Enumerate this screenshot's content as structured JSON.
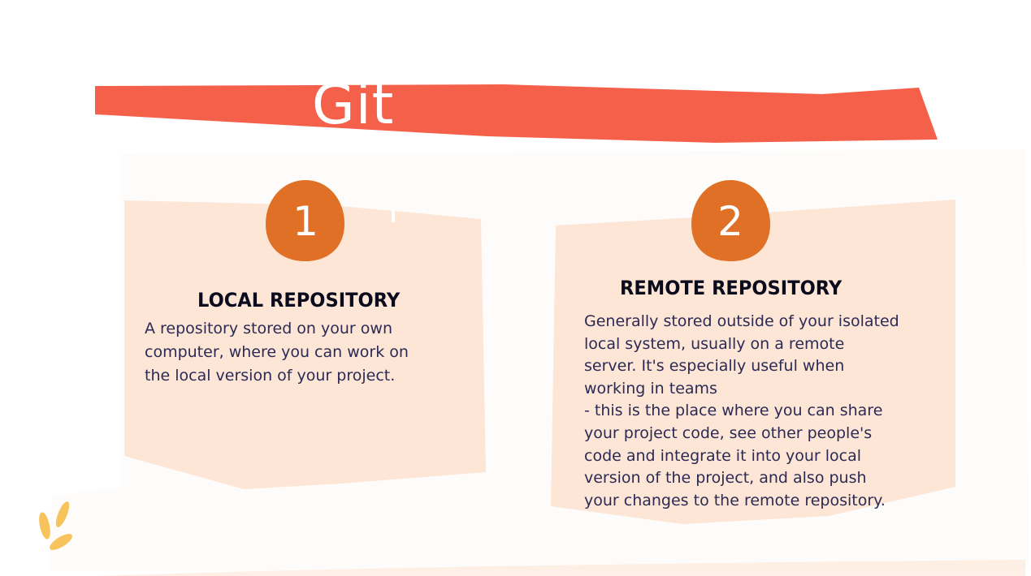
{
  "title": "Git",
  "cards": [
    {
      "number": "1",
      "heading": "LOCAL REPOSITORY",
      "body": " A repository stored on your own\ncomputer, where you can work on\nthe  local version of your project."
    },
    {
      "number": "2",
      "heading": "REMOTE REPOSITORY",
      "body": "Generally stored outside of your isolated\nlocal system, usually on a remote\nserver.  It's especially useful when\nworking in teams\n- this is the place where you can share\nyour  project code, see other people's\ncode and  integrate it into your local\nversion of the  project, and also push\nyour changes to the  remote repository."
    }
  ],
  "colors": {
    "banner": "#f4604a",
    "badge": "#e07025",
    "card": "#fde6d6",
    "leaf": "#f7c35c",
    "heading": "#0b0b1e",
    "body": "#2b2a55"
  },
  "icons": {
    "decoration": "leaf-sprig-icon"
  }
}
